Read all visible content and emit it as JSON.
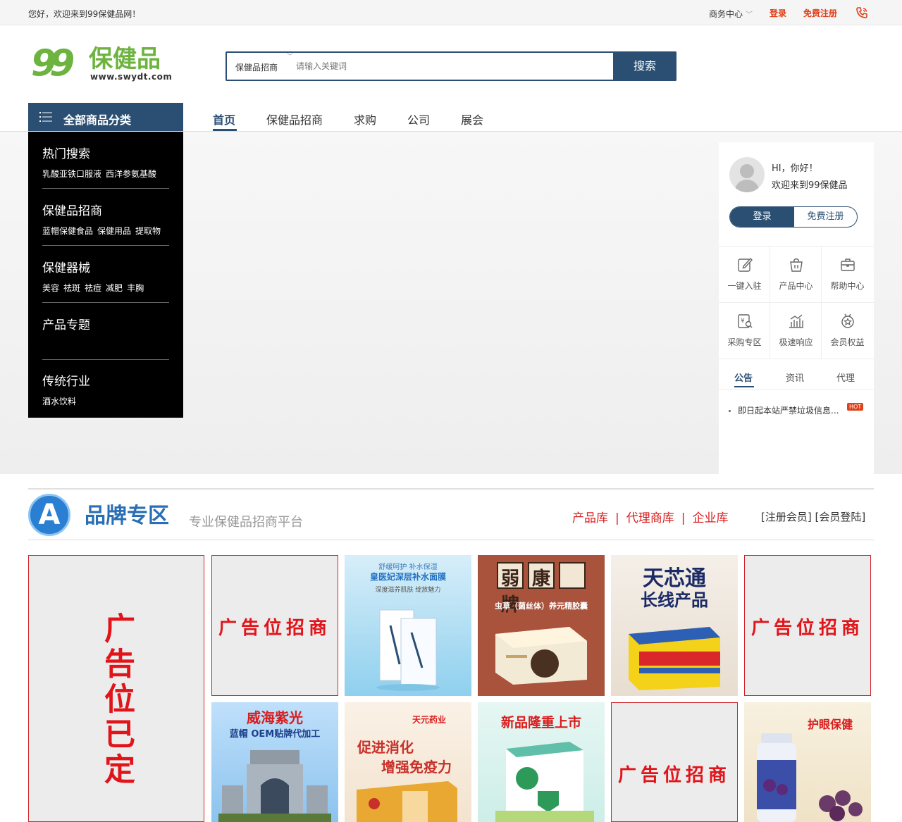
{
  "topbar": {
    "welcome": "您好，欢迎来到99保健品网！",
    "business_center": "商务中心",
    "login": "登录",
    "register": "免费注册"
  },
  "logo": {
    "digits": "99",
    "name": "保健品",
    "url": "www.swydt.com"
  },
  "search": {
    "category": "保健品招商",
    "placeholder": "请输入关键词",
    "button": "搜索"
  },
  "nav": {
    "all_categories": "全部商品分类",
    "items": [
      "首页",
      "保健品招商",
      "求购",
      "公司",
      "展会"
    ]
  },
  "categories": [
    {
      "title": "热门搜索",
      "links": [
        "乳酸亚铁口服液",
        "西洋参氨基酸"
      ]
    },
    {
      "title": "保健品招商",
      "links": [
        "蓝帽保健食品",
        "保健用品",
        "提取物"
      ]
    },
    {
      "title": "保健器械",
      "links": [
        "美容",
        "祛斑",
        "祛痘",
        "减肥",
        "丰胸"
      ]
    },
    {
      "title": "产品专题",
      "links": []
    },
    {
      "title": "传统行业",
      "links": [
        "酒水饮料"
      ]
    }
  ],
  "user": {
    "greeting": "HI，你好！",
    "welcome": "欢迎来到99保健品",
    "login": "登录",
    "register": "免费注册",
    "shortcuts": [
      "一键入驻",
      "产品中心",
      "帮助中心",
      "采购专区",
      "极速响应",
      "会员权益"
    ],
    "tabs": [
      "公告",
      "资讯",
      "代理"
    ],
    "notice": "即日起本站严禁垃圾信息...",
    "notice_badge": "HOT"
  },
  "brand": {
    "badge": "A",
    "title": "品牌专区",
    "subtitle": "专业保健品招商平台",
    "links": [
      "产品库",
      "代理商库",
      "企业库"
    ],
    "account": "[注册会员]  [会员登陆]",
    "ad_reserved": "广告位已定",
    "ad_open": "广告位招商",
    "products": [
      {
        "headline": "皇医妃深层补水面膜",
        "tag": "舒缓呵护 补水保湿",
        "sub": "深度滋养肌肤 绽放魅力"
      },
      {
        "headline": "弱康牌",
        "sub": "虫草（菌丝体）养元精胶囊"
      },
      {
        "headline": "天芯通",
        "sub": "长线产品"
      },
      {
        "headline": "威海紫光",
        "sub": "蓝帽 OEM贴牌代加工"
      },
      {
        "headline": "促进消化",
        "sub": "增强免疫力",
        "tag": "天元药业"
      },
      {
        "headline": "新品隆重上市"
      },
      {
        "headline": "护眼保健"
      }
    ]
  },
  "colors": {
    "primary": "#2a4f72",
    "accent": "#e0401a",
    "brand_green": "#6db33f",
    "ad_red": "#e1141a"
  }
}
